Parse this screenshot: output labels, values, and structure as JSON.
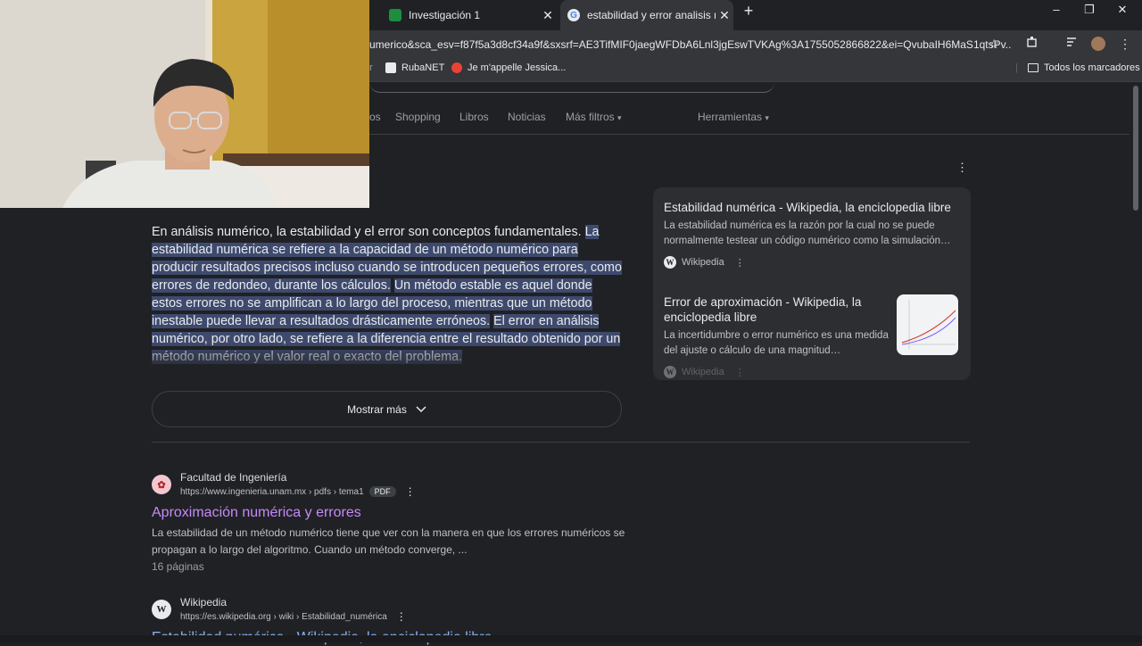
{
  "tabs": [
    {
      "title": "Investigación 1",
      "icon": "classroom-icon",
      "color": "#1e8e3e"
    },
    {
      "title": "estabilidad y error analisis numérico",
      "icon": "google-icon",
      "color": "#4285f4"
    }
  ],
  "window": {
    "minimize": "–",
    "restore": "❐",
    "close": "✕",
    "new_tab": "+"
  },
  "address": {
    "url": "umerico&sca_esv=f87f5a3d8cf34a9f&sxsrf=AE3TifMIF0jaegWFDbA6Lnl3jgEswTVKAg%3A1755052866822&ei=QvubaIH6MaS1qtsPv..."
  },
  "bookmarks": [
    {
      "label": "RubaNET",
      "color": "#e8eaed"
    },
    {
      "label": "Je m'appelle Jessica...",
      "color": "#ea4335"
    }
  ],
  "bookmarks_all": "Todos los marcadores",
  "nav": {
    "items": [
      "os",
      "Shopping",
      "Libros",
      "Noticias",
      "Más filtros",
      "Herramientas"
    ]
  },
  "answer": {
    "p1": "En análisis numérico, la estabilidad y el error son conceptos fundamentales.",
    "p2": "La estabilidad numérica se refiere a la capacidad de un método numérico para producir resultados precisos incluso cuando se introducen pequeños errores, como errores de redondeo, durante los cálculos.",
    "p3": "Un método estable es aquel donde estos errores no se amplifican a lo largo del proceso, mientras que un método inestable puede llevar a resultados drásticamente erróneos.",
    "p4": "El error en análisis numérico, por otro lado, se refiere a la diferencia entre el resultado obtenido por un método numérico y el valor real o exacto del problema.",
    "show_more": "Mostrar más"
  },
  "panel": {
    "card1": {
      "title": "Estabilidad numérica - Wikipedia, la enciclopedia libre",
      "snippet": "La estabilidad numérica es la razón por la cual no se puede normalmente testear un código numérico como la simulación…",
      "source": "Wikipedia"
    },
    "card2": {
      "title": "Error de aproximación - Wikipedia, la enciclopedia libre",
      "snippet": "La incertidumbre o error numérico es una medida del ajuste o cálculo de una magnitud…",
      "source": "Wikipedia"
    }
  },
  "results": [
    {
      "site": "Facultad de Ingeniería",
      "url": "https://www.ingenieria.unam.mx › pdfs › tema1",
      "badge": "PDF",
      "title": "Aproximación numérica y errores",
      "snippet": "La estabilidad de un método numérico tiene que ver con la manera en que los errores numéricos se propagan a lo largo del algoritmo. Cuando un método converge, ...",
      "meta": "16 páginas"
    },
    {
      "site": "Wikipedia",
      "url": "https://es.wikipedia.org › wiki › Estabilidad_numérica",
      "title": "Estabilidad numérica - Wikipedia, la enciclopedia libre"
    }
  ]
}
